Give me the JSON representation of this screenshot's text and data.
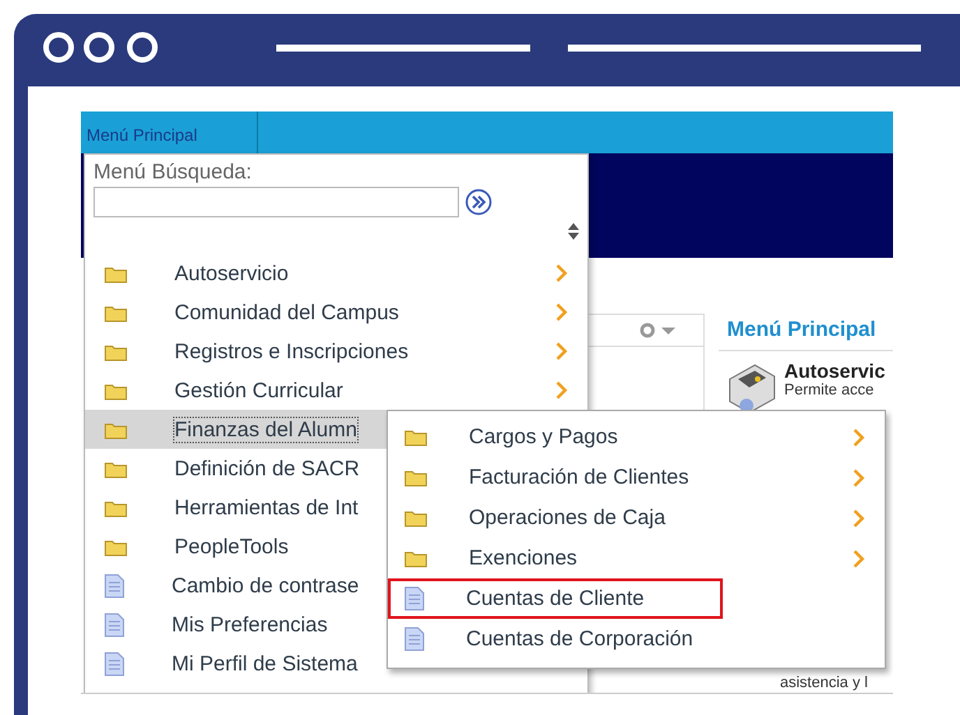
{
  "tab": {
    "label": "Menú Principal"
  },
  "menu": {
    "search_label": "Menú Búsqueda:",
    "items": [
      {
        "label": "Autoservicio",
        "kind": "folder",
        "arrow": true,
        "selected": false
      },
      {
        "label": "Comunidad del Campus",
        "kind": "folder",
        "arrow": true,
        "selected": false
      },
      {
        "label": "Registros e Inscripciones",
        "kind": "folder",
        "arrow": true,
        "selected": false
      },
      {
        "label": "Gestión Curricular",
        "kind": "folder",
        "arrow": true,
        "selected": false
      },
      {
        "label": "Finanzas del Alumn",
        "kind": "folder",
        "selected": true
      },
      {
        "label": "Definición de SACR",
        "kind": "folder",
        "selected": false
      },
      {
        "label": "Herramientas de Int",
        "kind": "folder",
        "selected": false
      },
      {
        "label": "PeopleTools",
        "kind": "folder",
        "selected": false
      },
      {
        "label": "Cambio de contrase",
        "kind": "page",
        "selected": false
      },
      {
        "label": "Mis Preferencias",
        "kind": "page",
        "selected": false
      },
      {
        "label": "Mi Perfil de Sistema",
        "kind": "page",
        "selected": false
      }
    ]
  },
  "submenu": {
    "items": [
      {
        "label": "Cargos y Pagos",
        "kind": "folder",
        "arrow": true,
        "highlighted": false
      },
      {
        "label": "Facturación de Clientes",
        "kind": "folder",
        "arrow": true,
        "highlighted": false
      },
      {
        "label": "Operaciones de Caja",
        "kind": "folder",
        "arrow": true,
        "highlighted": false
      },
      {
        "label": "Exenciones",
        "kind": "folder",
        "arrow": true,
        "highlighted": false
      },
      {
        "label": "Cuentas de Cliente",
        "kind": "page",
        "arrow": false,
        "highlighted": true
      },
      {
        "label": "Cuentas de Corporación",
        "kind": "page",
        "arrow": false,
        "highlighted": false
      }
    ]
  },
  "portlet": {
    "title": "Menú Principal",
    "entry_title": "Autoservic",
    "entry_text": "Permite acce",
    "footer_text": "asistencia y l"
  }
}
